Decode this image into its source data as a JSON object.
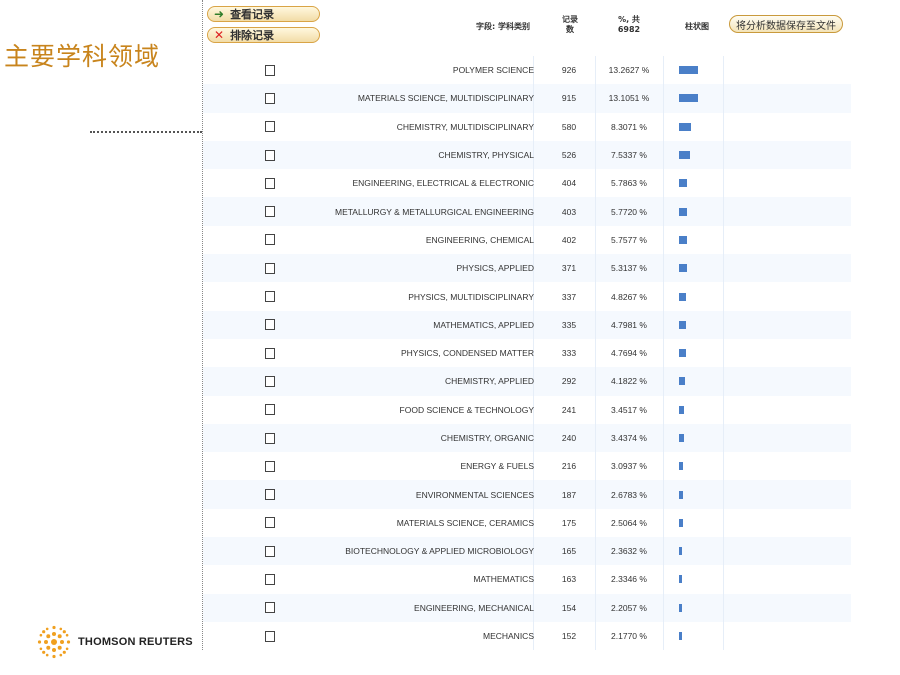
{
  "slide": {
    "title": "主要学科领域",
    "logo_text": "THOMSON REUTERS"
  },
  "toolbar": {
    "view_label": "查看记录",
    "exclude_label": "排除记录",
    "save_label": "将分析数据保存至文件"
  },
  "columns": {
    "field": "字段: 学科类别",
    "count": "记录\n数",
    "percent": "%, 共\n6982",
    "bar": "柱状图"
  },
  "colors": {
    "bar": "#4a7fc8",
    "title": "#c8841c"
  },
  "chart_data": {
    "type": "table",
    "total": 6982,
    "rows": [
      {
        "category": "POLYMER SCIENCE",
        "count": 926,
        "percent": "13.2627 %",
        "pct": 13.2627
      },
      {
        "category": "MATERIALS SCIENCE, MULTIDISCIPLINARY",
        "count": 915,
        "percent": "13.1051 %",
        "pct": 13.1051
      },
      {
        "category": "CHEMISTRY, MULTIDISCIPLINARY",
        "count": 580,
        "percent": "8.3071 %",
        "pct": 8.3071
      },
      {
        "category": "CHEMISTRY, PHYSICAL",
        "count": 526,
        "percent": "7.5337 %",
        "pct": 7.5337
      },
      {
        "category": "ENGINEERING, ELECTRICAL & ELECTRONIC",
        "count": 404,
        "percent": "5.7863 %",
        "pct": 5.7863
      },
      {
        "category": "METALLURGY & METALLURGICAL ENGINEERING",
        "count": 403,
        "percent": "5.7720 %",
        "pct": 5.772
      },
      {
        "category": "ENGINEERING, CHEMICAL",
        "count": 402,
        "percent": "5.7577 %",
        "pct": 5.7577
      },
      {
        "category": "PHYSICS, APPLIED",
        "count": 371,
        "percent": "5.3137 %",
        "pct": 5.3137
      },
      {
        "category": "PHYSICS, MULTIDISCIPLINARY",
        "count": 337,
        "percent": "4.8267 %",
        "pct": 4.8267
      },
      {
        "category": "MATHEMATICS, APPLIED",
        "count": 335,
        "percent": "4.7981 %",
        "pct": 4.7981
      },
      {
        "category": "PHYSICS, CONDENSED MATTER",
        "count": 333,
        "percent": "4.7694 %",
        "pct": 4.7694
      },
      {
        "category": "CHEMISTRY, APPLIED",
        "count": 292,
        "percent": "4.1822 %",
        "pct": 4.1822
      },
      {
        "category": "FOOD SCIENCE & TECHNOLOGY",
        "count": 241,
        "percent": "3.4517 %",
        "pct": 3.4517
      },
      {
        "category": "CHEMISTRY, ORGANIC",
        "count": 240,
        "percent": "3.4374 %",
        "pct": 3.4374
      },
      {
        "category": "ENERGY & FUELS",
        "count": 216,
        "percent": "3.0937 %",
        "pct": 3.0937
      },
      {
        "category": "ENVIRONMENTAL SCIENCES",
        "count": 187,
        "percent": "2.6783 %",
        "pct": 2.6783
      },
      {
        "category": "MATERIALS SCIENCE, CERAMICS",
        "count": 175,
        "percent": "2.5064 %",
        "pct": 2.5064
      },
      {
        "category": "BIOTECHNOLOGY & APPLIED MICROBIOLOGY",
        "count": 165,
        "percent": "2.3632 %",
        "pct": 2.3632
      },
      {
        "category": "MATHEMATICS",
        "count": 163,
        "percent": "2.3346 %",
        "pct": 2.3346
      },
      {
        "category": "ENGINEERING, MECHANICAL",
        "count": 154,
        "percent": "2.2057 %",
        "pct": 2.2057
      },
      {
        "category": "MECHANICS",
        "count": 152,
        "percent": "2.1770 %",
        "pct": 2.177
      }
    ]
  }
}
